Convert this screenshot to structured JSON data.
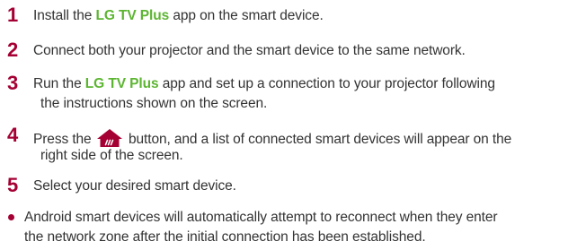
{
  "steps": [
    {
      "number": "1",
      "lines": [
        {
          "pre": "Install the ",
          "highlight": "LG TV Plus",
          "post": " app on the smart device."
        }
      ]
    },
    {
      "number": "2",
      "lines": [
        {
          "text": "Connect both your projector and the smart device to the same network."
        }
      ]
    },
    {
      "number": "3",
      "lines": [
        {
          "pre": "Run the ",
          "highlight": "LG TV Plus",
          "post": " app and set up a connection to your projector following"
        },
        {
          "text": "the instructions shown on the screen."
        }
      ]
    },
    {
      "number": "4",
      "lines": [
        {
          "pre": "Press the ",
          "icon": "home-icon",
          "post": " button, and a list of connected smart devices will appear on the"
        },
        {
          "text": "right side of the screen."
        }
      ]
    },
    {
      "number": "5",
      "lines": [
        {
          "text": "Select your desired smart device."
        }
      ]
    }
  ],
  "note": {
    "lines": [
      "Android smart devices will automatically attempt to reconnect when they enter",
      "the network zone after the initial connection has been established."
    ]
  },
  "colors": {
    "number": "#a50034",
    "highlight": "#5cb531",
    "text": "#333333",
    "bullet": "#a50034",
    "home_icon": "#a50034"
  }
}
